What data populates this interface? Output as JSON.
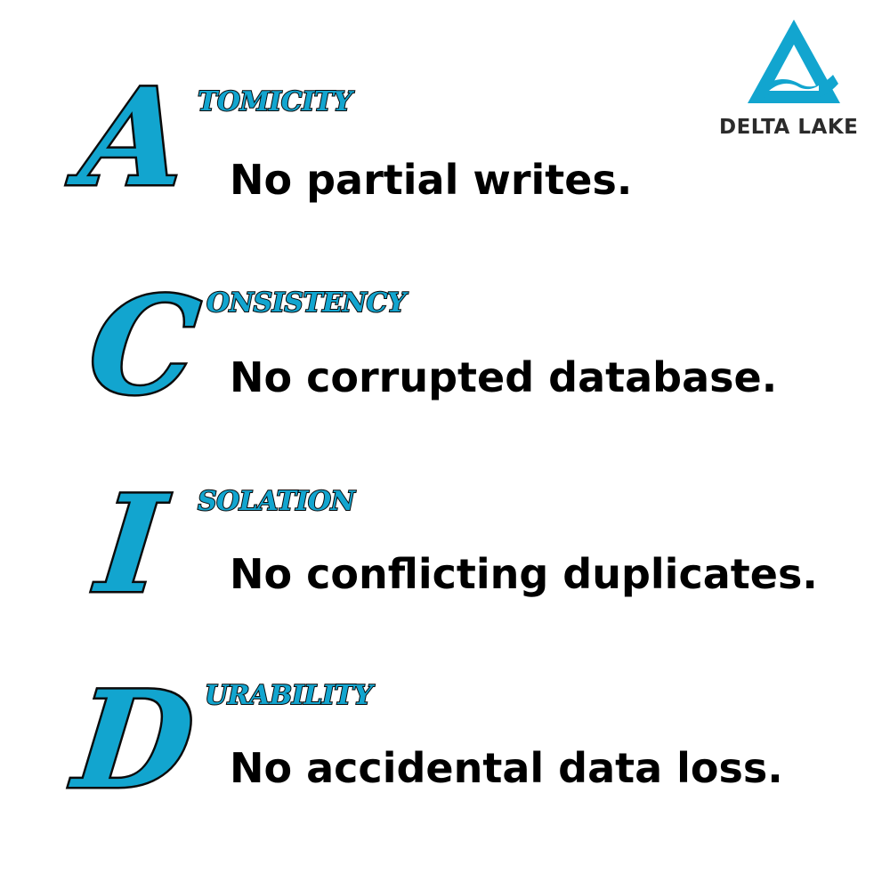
{
  "logo": {
    "icon": "delta-triangle-wave-icon",
    "text": "DELTA LAKE",
    "color": "#12a5cf",
    "text_color": "#2b2b2b"
  },
  "accent_color": "#12a5cf",
  "items": [
    {
      "letter": "A",
      "rest": "TOMICITY",
      "description": "No partial writes."
    },
    {
      "letter": "C",
      "rest": "ONSISTENCY",
      "description": "No corrupted database."
    },
    {
      "letter": "I",
      "rest": "SOLATION",
      "description": "No conflicting duplicates."
    },
    {
      "letter": "D",
      "rest": "URABILITY",
      "description": "No accidental data loss."
    }
  ]
}
